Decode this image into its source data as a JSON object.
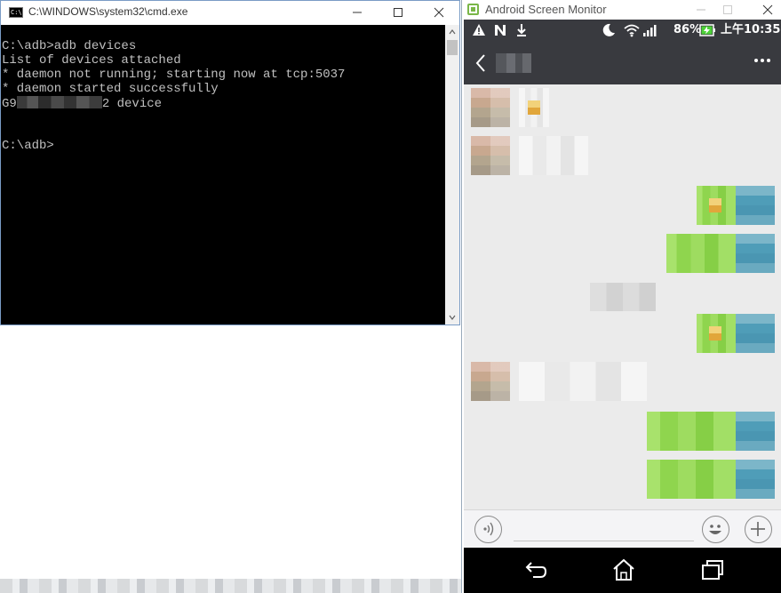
{
  "cmd": {
    "title": "C:\\WINDOWS\\system32\\cmd.exe",
    "icon_glyph": "C:\\",
    "lines": {
      "l0": "C:\\adb>adb devices",
      "l1": "List of devices attached",
      "l2": "* daemon not running; starting now at tcp:5037",
      "l3": "* daemon started successfully",
      "l4_prefix": "G9",
      "l4_suffix": "2 device",
      "l6": "C:\\adb>"
    }
  },
  "asm": {
    "title": "Android Screen Monitor",
    "status": {
      "battery": "86%",
      "time": "上午10:35"
    }
  },
  "icons": [
    "warning-icon",
    "n-icon",
    "download-icon",
    "moon-icon",
    "wifi-icon",
    "signal-icon",
    "battery-charging-icon",
    "back-icon",
    "more-icon",
    "voice-icon",
    "emoji-icon",
    "plus-icon",
    "nav-back-icon",
    "nav-home-icon",
    "nav-recents-icon"
  ],
  "colors": {
    "terminal_bg": "#000000",
    "terminal_fg": "#c0c0c0",
    "wechat_bar": "#393a3f",
    "chat_bg": "#ebebeb",
    "bubble_sent": "#9edc60"
  }
}
